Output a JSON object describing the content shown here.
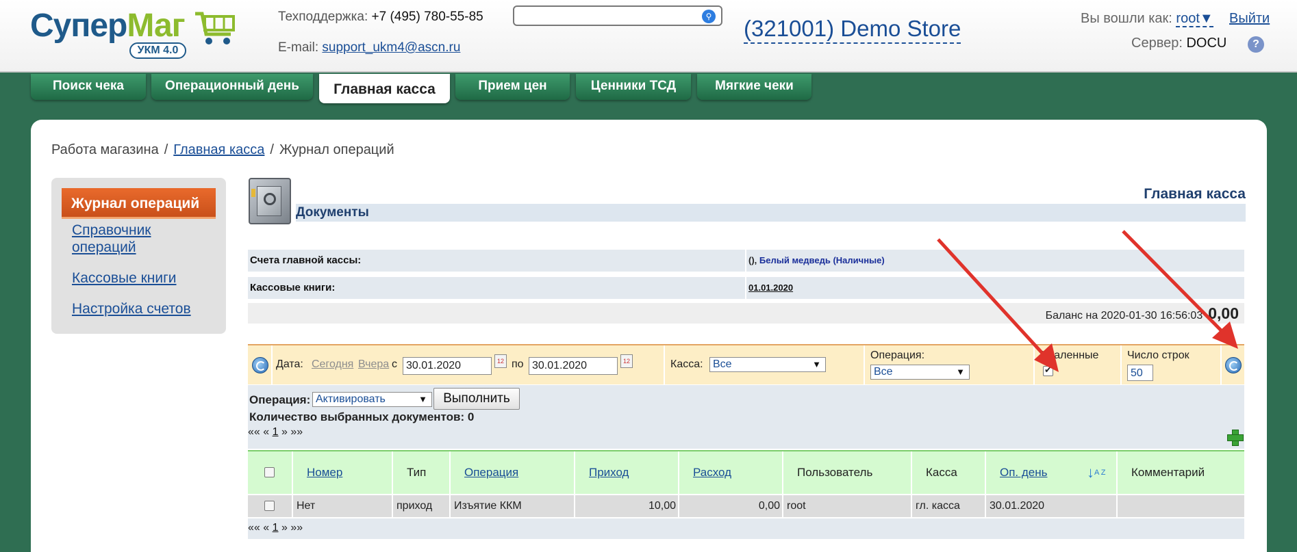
{
  "header": {
    "logo_main": "Супер",
    "logo_accent": "Маг",
    "logo_badge": "УКМ 4.0",
    "support_label": "Техподдержка:",
    "support_phone": "+7 (495) 780-55-85",
    "email_label": "E-mail:",
    "email": "support_ukm4@ascn.ru",
    "search_value": "",
    "store_name": "(321001) Demo Store",
    "logged_in_label": "Вы вошли как:",
    "user": "root",
    "logout": "Выйти",
    "server_label": "Сервер:",
    "server": "DOCU",
    "help": "?"
  },
  "nav_tabs": [
    {
      "label": "Поиск чека",
      "active": false
    },
    {
      "label": "Операционный день",
      "active": false
    },
    {
      "label": "Главная касса",
      "active": true
    },
    {
      "label": "Прием цен",
      "active": false
    },
    {
      "label": "Ценники ТСД",
      "active": false
    },
    {
      "label": "Мягкие чеки",
      "active": false
    }
  ],
  "breadcrumb": {
    "root": "Работа магазина",
    "sep": "/",
    "section": "Главная касса",
    "current": "Журнал операций"
  },
  "sidebar": {
    "active": "Журнал операций",
    "items": [
      "Справочник операций",
      "Кассовые книги",
      "Настройка счетов"
    ]
  },
  "content": {
    "title": "Главная касса",
    "docs_header": "Документы",
    "accounts_label": "Счета главной кассы:",
    "accounts_prefix": "(),",
    "accounts_value": "Белый медведь (Наличные)",
    "books_label": "Кассовые книги:",
    "books_value": "01.01.2020",
    "balance_label": "Баланс на 2020-01-30 16:56:03",
    "balance_value": "0,00"
  },
  "filter": {
    "date_label": "Дата:",
    "today": "Сегодня",
    "yesterday": "Вчера",
    "from_label": "с",
    "date_from": "30.01.2020",
    "to_label": "по",
    "date_to": "30.01.2020",
    "kassa_label": "Касса:",
    "kassa_value": "Все",
    "operation_label": "Операция:",
    "operation_value": "Все",
    "deleted_label": "Удаленные",
    "deleted_checked": true,
    "rows_label": "Число строк",
    "rows_value": "50"
  },
  "operation_panel": {
    "label": "Операция:",
    "select_value": "Активировать",
    "execute": "Выполнить",
    "selected_count": "Количество выбранных документов: 0",
    "pager": {
      "first": "««",
      "prev": "«",
      "page": "1",
      "next": "»",
      "last": "»»"
    }
  },
  "table": {
    "columns": [
      "Номер",
      "Тип",
      "Операция",
      "Приход",
      "Расход",
      "Пользователь",
      "Касса",
      "Оп. день",
      "Комментарий"
    ],
    "rows": [
      {
        "number": "Нет",
        "type": "приход",
        "operation": "Изъятие ККМ",
        "income": "10,00",
        "expense": "0,00",
        "user": "root",
        "kassa": "гл. касса",
        "opday": "30.01.2020",
        "comment": ""
      }
    ]
  },
  "icons": [
    "cart-icon",
    "search-icon",
    "help-icon",
    "safe-icon",
    "refresh-icon",
    "calendar-icon",
    "add-icon",
    "sort-icon"
  ],
  "colors": {
    "brand_blue": "#1f5a8a",
    "brand_green": "#8dbb2e",
    "nav_green": "#2f6e52",
    "active_orange": "#e96a2c",
    "arrow_red": "#e0332b"
  }
}
